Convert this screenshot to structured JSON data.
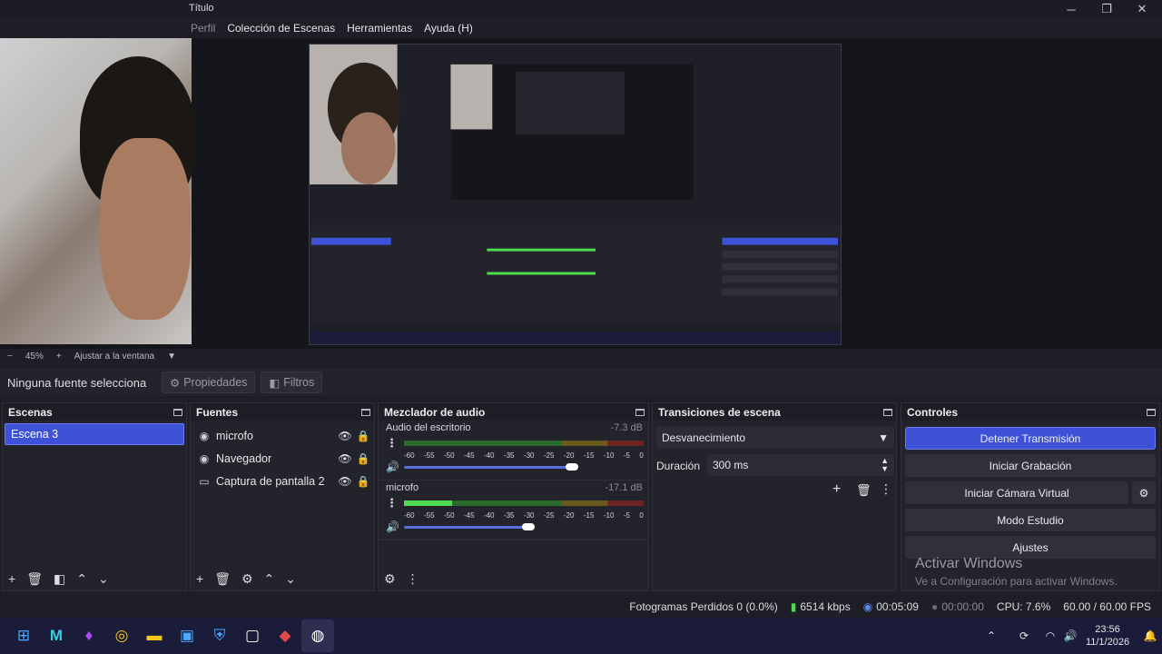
{
  "window": {
    "title": "Título",
    "minimize": "─",
    "maximize": "❐",
    "close": "✕"
  },
  "menu": {
    "items": [
      "Perfil",
      "Colección de Escenas",
      "Herramientas",
      "Ayuda (H)"
    ]
  },
  "zoom": {
    "minus": "−",
    "level": "45%",
    "plus": "+",
    "fit": "Ajustar a la ventana",
    "chevron": "▼"
  },
  "sourcebar": {
    "label": "Ninguna fuente selecciona",
    "properties": "Propiedades",
    "filters": "Filtros"
  },
  "scenes": {
    "title": "Escenas",
    "items": [
      "Escena 3"
    ]
  },
  "sources": {
    "title": "Fuentes",
    "items": [
      {
        "label": "microfo",
        "icon": "mic-icon"
      },
      {
        "label": "Navegador",
        "icon": "globe-icon"
      },
      {
        "label": "Captura de pantalla 2",
        "icon": "monitor-icon"
      }
    ]
  },
  "mixer": {
    "title": "Mezclador de audio",
    "ticks": [
      "-60",
      "-55",
      "-50",
      "-45",
      "-40",
      "-35",
      "-30",
      "-25",
      "-20",
      "-15",
      "-10",
      "-5",
      "0"
    ],
    "channels": [
      {
        "name": "Audio del escritorio",
        "db": "-7.3 dB",
        "level": 0,
        "volume": 0.7
      },
      {
        "name": "microfo",
        "db": "-17.1 dB",
        "level": 0.2,
        "volume": 0.52
      }
    ]
  },
  "transitions": {
    "title": "Transiciones de escena",
    "selected": "Desvanecimiento",
    "duration_label": "Duración",
    "duration_value": "300 ms"
  },
  "controls": {
    "title": "Controles",
    "stop_stream": "Detener Transmisión",
    "start_recording": "Iniciar Grabación",
    "start_virtual_cam": "Iniciar Cámara Virtual",
    "studio_mode": "Modo Estudio",
    "settings": "Ajustes"
  },
  "watermark": {
    "line1": "Activar Windows",
    "line2": "Ve a Configuración para activar Windows."
  },
  "status": {
    "dropped_frames": "Fotogramas Perdidos 0 (0.0%)",
    "bitrate": "6514 kbps",
    "stream_time": "00:05:09",
    "rec_time": "00:00:00",
    "cpu": "CPU: 7.6%",
    "fps": "60.00 / 60.00 FPS"
  },
  "taskbar": {
    "time": "23:56",
    "date": "11/1/2026"
  },
  "colors": {
    "accent": "#3d52d6",
    "panel": "#22232b",
    "taskbar": "#1b1c3a"
  }
}
